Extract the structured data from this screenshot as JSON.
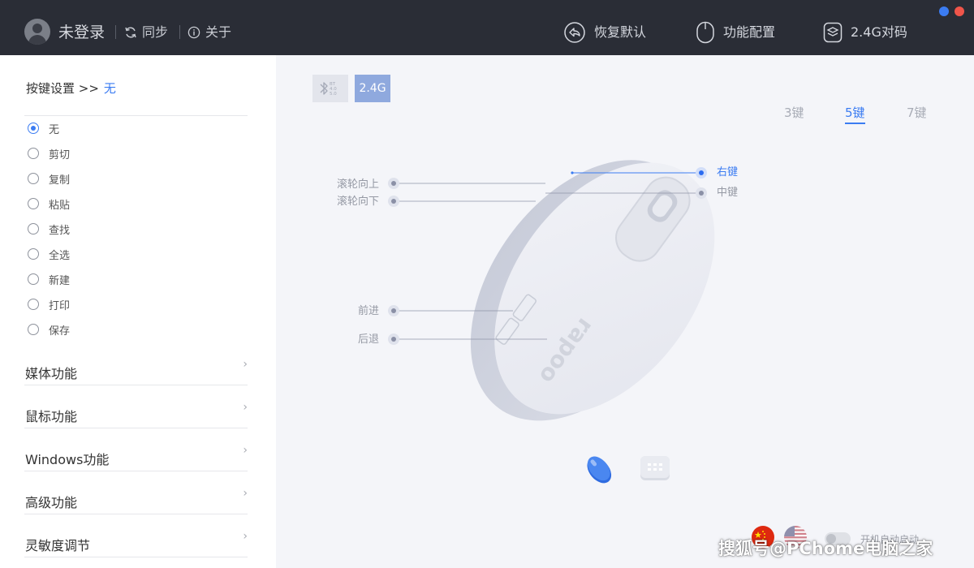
{
  "header": {
    "user_label": "未登录",
    "sync_label": "同步",
    "about_label": "关于",
    "actions": [
      {
        "label": "恢复默认",
        "icon": "reset-icon"
      },
      {
        "label": "功能配置",
        "icon": "mouse-config-icon"
      },
      {
        "label": "2.4G对码",
        "icon": "pair-icon"
      }
    ],
    "window_dots": [
      "#3b7cf2",
      "#f0554a"
    ]
  },
  "sidebar": {
    "section_title": "按键设置 >>",
    "section_value": "无",
    "options": [
      {
        "label": "无",
        "selected": true
      },
      {
        "label": "剪切",
        "selected": false
      },
      {
        "label": "复制",
        "selected": false
      },
      {
        "label": "粘贴",
        "selected": false
      },
      {
        "label": "查找",
        "selected": false
      },
      {
        "label": "全选",
        "selected": false
      },
      {
        "label": "新建",
        "selected": false
      },
      {
        "label": "打印",
        "selected": false
      },
      {
        "label": "保存",
        "selected": false
      }
    ],
    "categories": [
      {
        "label": "媒体功能"
      },
      {
        "label": "鼠标功能"
      },
      {
        "label": "Windows功能"
      },
      {
        "label": "高级功能"
      },
      {
        "label": "灵敏度调节"
      }
    ]
  },
  "mode": {
    "bt_label": "BT 4.0 5.0",
    "rf_label": "2.4G",
    "active": "2.4G"
  },
  "key_tabs": [
    {
      "label": "3键",
      "active": false
    },
    {
      "label": "5键",
      "active": true
    },
    {
      "label": "7键",
      "active": false
    }
  ],
  "callouts": {
    "right_button": "右键",
    "middle_button": "中键",
    "scroll_up": "滚轮向上",
    "scroll_down": "滚轮向下",
    "forward": "前进",
    "back": "后退"
  },
  "mouse_brand": "rapoo",
  "device_selector": [
    {
      "icon": "mouse-device-icon",
      "active": true
    },
    {
      "icon": "keyboard-device-icon",
      "active": false
    }
  ],
  "footer": {
    "autostart_label": "开机自动启动",
    "autostart_on": false,
    "language_icons": [
      "china-flag-icon",
      "usa-flag-icon"
    ],
    "watermark": "搜狐号@PChome电脑之家"
  },
  "colors": {
    "accent": "#3b7cf2",
    "topbar": "#2a2d36",
    "panel_bg": "#f4f5f9"
  }
}
